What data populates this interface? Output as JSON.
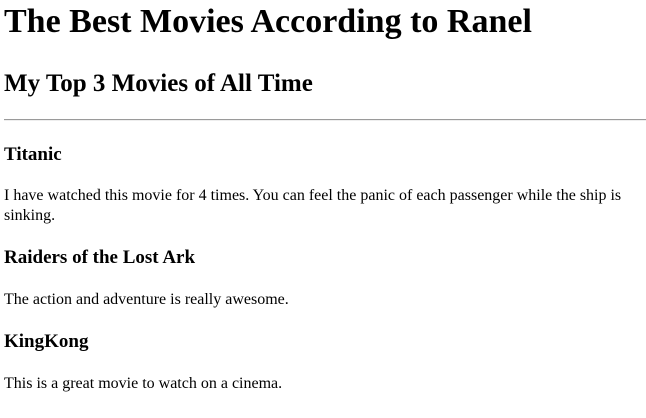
{
  "page": {
    "title": "The Best Movies According to Ranel",
    "subtitle": "My Top 3 Movies of All Time"
  },
  "movies": [
    {
      "name": "Titanic",
      "description": "I have watched this movie for 4 times. You can feel the panic of each passenger while the ship is sinking."
    },
    {
      "name": "Raiders of the Lost Ark",
      "description": "The action and adventure is really awesome."
    },
    {
      "name": "KingKong",
      "description": "This is a great movie to watch on a cinema."
    }
  ]
}
